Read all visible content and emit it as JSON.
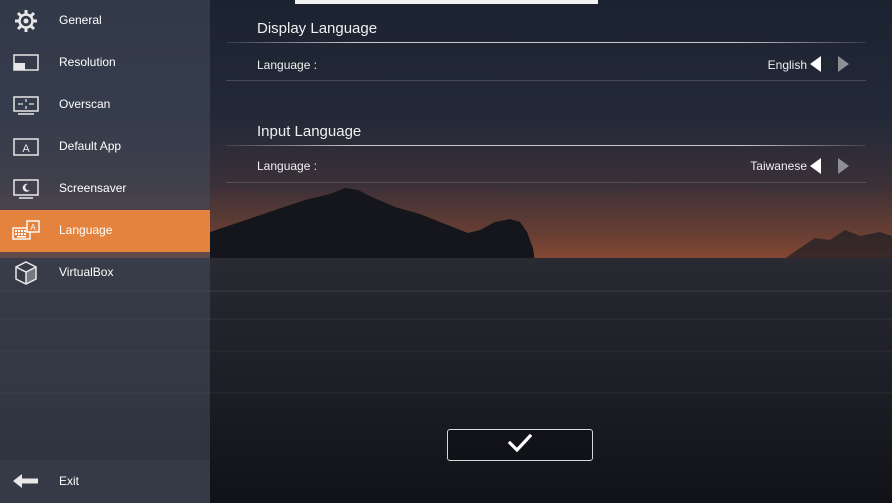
{
  "sidebar": {
    "items": [
      {
        "label": "General",
        "icon": "gear-icon"
      },
      {
        "label": "Resolution",
        "icon": "resolution-icon"
      },
      {
        "label": "Overscan",
        "icon": "overscan-icon"
      },
      {
        "label": "Default App",
        "icon": "default-app-icon"
      },
      {
        "label": "Screensaver",
        "icon": "screensaver-icon"
      },
      {
        "label": "Language",
        "icon": "keyboard-language-icon",
        "active": true
      },
      {
        "label": "VirtualBox",
        "icon": "virtualbox-cube-icon"
      }
    ],
    "exit": {
      "label": "Exit",
      "icon": "arrow-left-icon"
    }
  },
  "display_language": {
    "title": "Display Language",
    "row_label": "Language :",
    "value": "English"
  },
  "input_language": {
    "title": "Input Language",
    "row_label": "Language :",
    "value": "Taiwanese"
  },
  "confirm": {
    "icon": "checkmark-icon"
  },
  "colors": {
    "accent": "#e4833e",
    "arrow_inactive": "#8e8f95"
  }
}
